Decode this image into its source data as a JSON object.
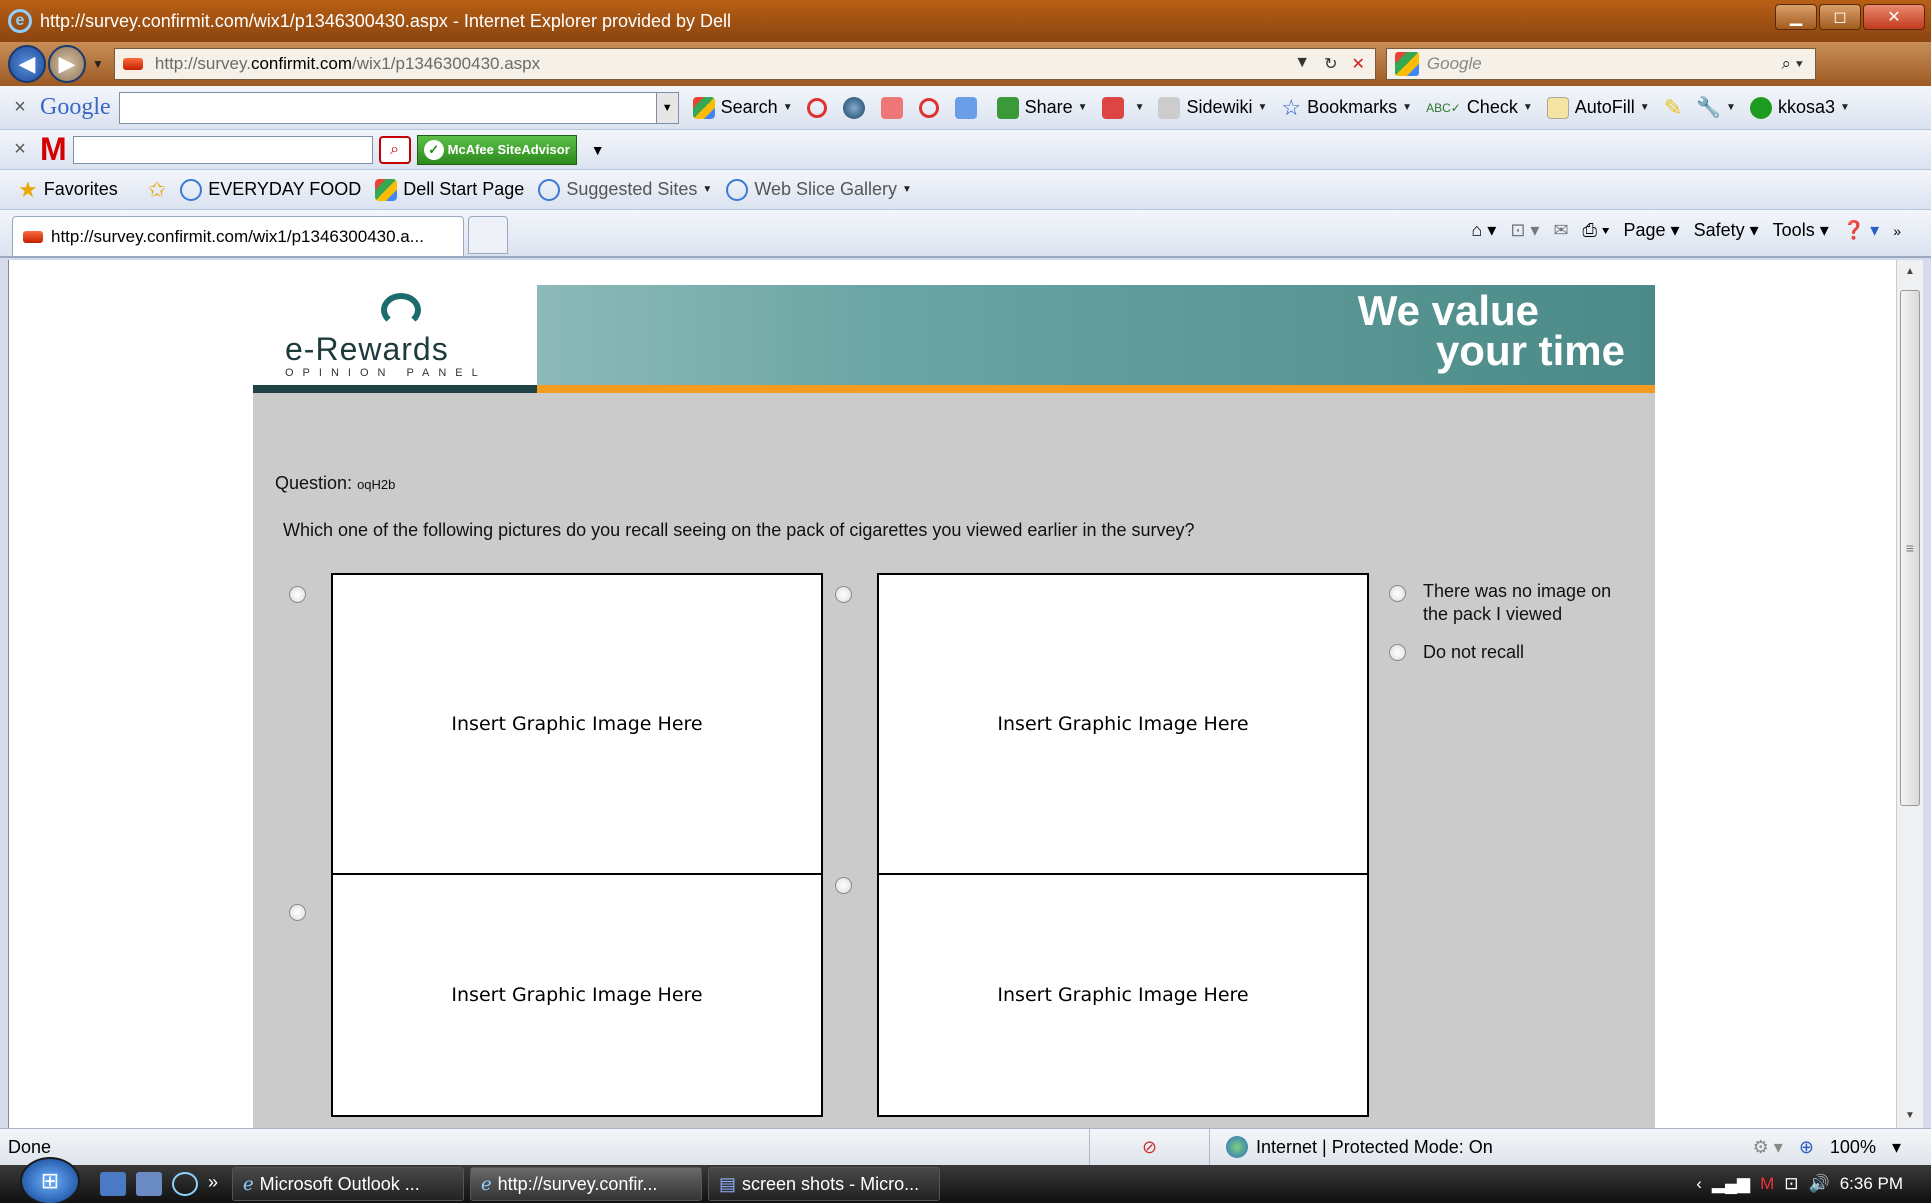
{
  "window": {
    "title": "http://survey.confirmit.com/wix1/p1346300430.aspx - Internet Explorer provided by Dell",
    "controls": [
      "minimize",
      "maximize",
      "close"
    ]
  },
  "address_bar": {
    "url_prefix": "http://survey.",
    "url_domain": "confirmit.com",
    "url_path": "/wix1/p1346300430.aspx",
    "search_placeholder": "Google"
  },
  "google_toolbar": {
    "logo": "Google",
    "items": {
      "search": "Search",
      "share": "Share",
      "sidewiki": "Sidewiki",
      "bookmarks": "Bookmarks",
      "check": "Check",
      "autofill": "AutoFill",
      "account": "kkosa3"
    }
  },
  "mcafee_toolbar": {
    "logo": "M",
    "siteadvisor": "McAfee SiteAdvisor"
  },
  "favorites_bar": {
    "favorites": "Favorites",
    "links": [
      "EVERYDAY FOOD",
      "Dell Start Page",
      "Suggested Sites",
      "Web Slice Gallery"
    ]
  },
  "tabs": {
    "active_tab": "http://survey.confirmit.com/wix1/p1346300430.a..."
  },
  "command_bar": {
    "page": "Page",
    "safety": "Safety",
    "tools": "Tools"
  },
  "survey": {
    "logo_main": "e-Rewards",
    "logo_sub": "OPINION PANEL",
    "tagline_line1": "We value",
    "tagline_line2": "your time",
    "question_label": "Question:",
    "question_code": "oqH2b",
    "question_text": "Which one of the following pictures do you recall seeing on the pack of cigarettes you viewed earlier in the survey?",
    "image_placeholder": "Insert Graphic Image Here",
    "options": {
      "no_image": "There was no image on the pack I viewed",
      "no_image_l1": "There was no image on",
      "no_image_l2": "the pack I viewed",
      "do_not_recall": "Do not recall"
    }
  },
  "status_bar": {
    "status": "Done",
    "zone": "Internet | Protected Mode: On",
    "zoom": "100%"
  },
  "taskbar": {
    "tasks": [
      "Microsoft Outlook ...",
      "http://survey.confir...",
      "screen shots - Micro..."
    ],
    "time": "6:36 PM"
  }
}
